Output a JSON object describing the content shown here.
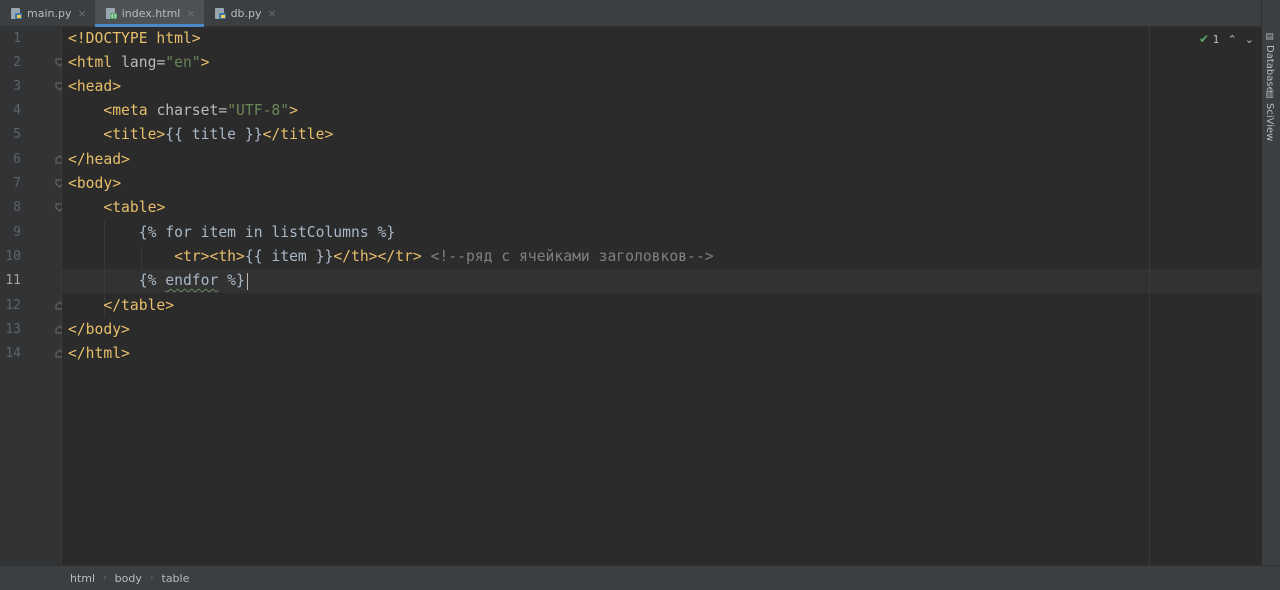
{
  "tabs": [
    {
      "label": "main.py",
      "icon": "python-file-icon",
      "active": false
    },
    {
      "label": "index.html",
      "icon": "html-file-icon",
      "active": true
    },
    {
      "label": "db.py",
      "icon": "python-file-icon",
      "active": false
    }
  ],
  "tab_close_glyph": "×",
  "right_tools": [
    {
      "label": "Database",
      "icon": "database-icon"
    },
    {
      "label": "SciView",
      "icon": "sciview-icon"
    }
  ],
  "inspection": {
    "count": "1"
  },
  "line_numbers": [
    "1",
    "2",
    "3",
    "4",
    "5",
    "6",
    "7",
    "8",
    "9",
    "10",
    "11",
    "12",
    "13",
    "14"
  ],
  "current_line": "11",
  "code": {
    "l1": {
      "tag": "<!DOCTYPE html>"
    },
    "l2": {
      "open": "<html ",
      "attr": "lang",
      "eq": "=",
      "val": "\"en\"",
      "close": ">"
    },
    "l3": {
      "tag": "<head>"
    },
    "l4": {
      "open": "<meta ",
      "attr": "charset",
      "eq": "=",
      "val": "\"UTF-8\"",
      "close": ">"
    },
    "l5": {
      "open": "<title>",
      "text": "{{ title }}",
      "close": "</title>"
    },
    "l6": {
      "tag": "</head>"
    },
    "l7": {
      "tag": "<body>"
    },
    "l8": {
      "tag": "<table>"
    },
    "l9": {
      "text": "{% for item in listColumns %}"
    },
    "l10": {
      "tags1": "<tr><th>",
      "text": "{{ item }}",
      "tags2": "</th></tr>",
      "comment": " <!--ряд с ячейками заголовков-->"
    },
    "l11": {
      "pre": "{% ",
      "kw": "endfor",
      "post": " %}"
    },
    "l12": {
      "tag": "</table>"
    },
    "l13": {
      "tag": "</body>"
    },
    "l14": {
      "tag": "</html>"
    }
  },
  "breadcrumbs": [
    "html",
    "body",
    "table"
  ],
  "colors": {
    "background": "#2b2b2b",
    "tag": "#e8bf6a",
    "string": "#6a8759",
    "comment": "#808080",
    "text": "#a9b7c6",
    "accent": "#4a88c7"
  }
}
